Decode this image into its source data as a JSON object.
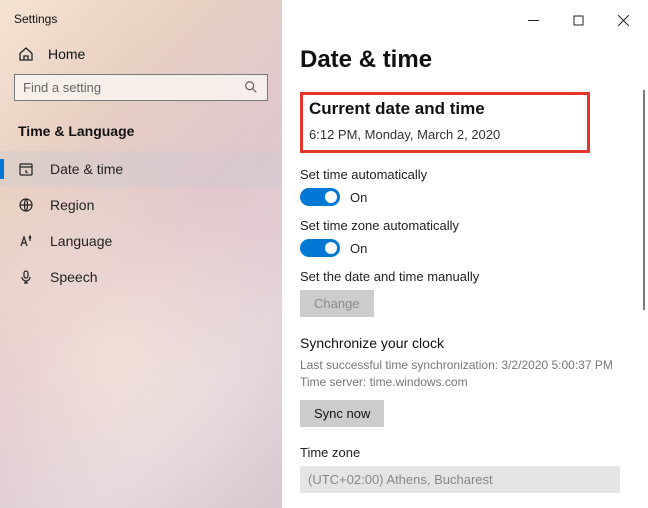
{
  "app_title": "Settings",
  "home_label": "Home",
  "search_placeholder": "Find a setting",
  "category": "Time & Language",
  "nav": [
    {
      "label": "Date & time"
    },
    {
      "label": "Region"
    },
    {
      "label": "Language"
    },
    {
      "label": "Speech"
    }
  ],
  "page_title": "Date & time",
  "current": {
    "heading": "Current date and time",
    "value": "6:12 PM, Monday, March 2, 2020"
  },
  "auto_time": {
    "label": "Set time automatically",
    "state": "On"
  },
  "auto_tz": {
    "label": "Set time zone automatically",
    "state": "On"
  },
  "manual": {
    "label": "Set the date and time manually",
    "button": "Change"
  },
  "sync": {
    "heading": "Synchronize your clock",
    "last": "Last successful time synchronization: 3/2/2020 5:00:37 PM",
    "server": "Time server: time.windows.com",
    "button": "Sync now"
  },
  "tz": {
    "heading": "Time zone",
    "value": "(UTC+02:00) Athens, Bucharest"
  }
}
